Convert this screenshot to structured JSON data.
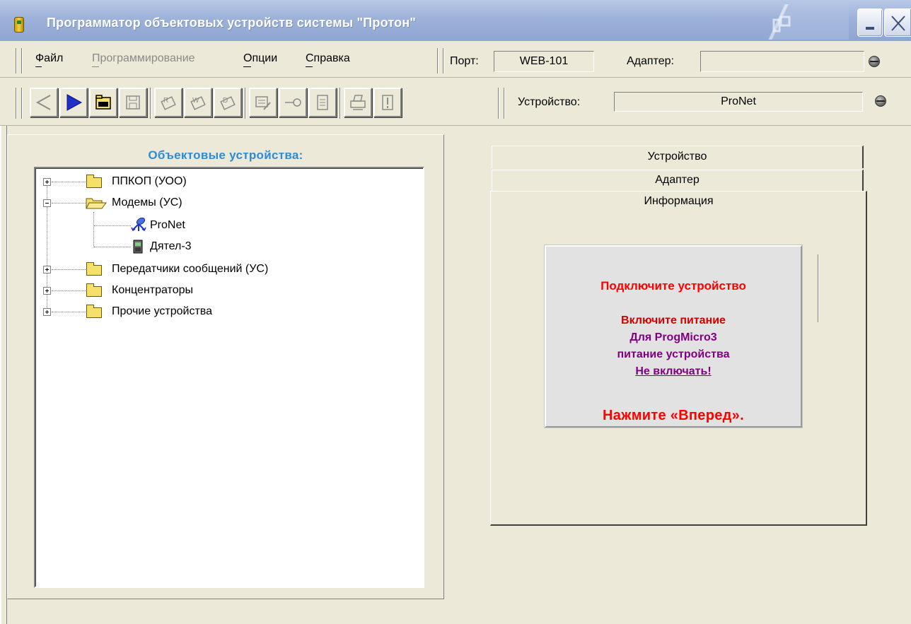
{
  "window": {
    "title": "Программатор объектовых устройств системы \"Протон\""
  },
  "menu": {
    "file": "Файл",
    "programming": "Программирование",
    "options": "Опции",
    "help": "Справка"
  },
  "status": {
    "port_label": "Порт:",
    "port_value": "WEB-101",
    "adapter_label": "Адаптер:",
    "adapter_value": "",
    "device_label": "Устройство:",
    "device_value": "ProNet"
  },
  "toolbar": {
    "buttons": [
      "back-icon",
      "forward-icon",
      "open-folder-icon",
      "save-icon",
      "read-chip-icon",
      "write-chip-icon",
      "erase-chip-icon",
      "edit-icon",
      "key-icon",
      "list-icon",
      "print-icon",
      "info-icon"
    ]
  },
  "tree": {
    "title": "Объектовые устройства:",
    "items": [
      {
        "label": "ППКОП (УОО)",
        "expanded": false
      },
      {
        "label": "Модемы (УС)",
        "expanded": true,
        "children": [
          "ProNet",
          "Дятел-3"
        ]
      },
      {
        "label": "Передатчики сообщений (УС)",
        "expanded": false
      },
      {
        "label": "Концентраторы",
        "expanded": false
      },
      {
        "label": "Прочие устройства",
        "expanded": false
      }
    ]
  },
  "tabs": {
    "device": "Устройство",
    "adapter": "Адаптер",
    "info": "Информация",
    "active": "Информация"
  },
  "info": {
    "connect": "Подключите устройство",
    "power_on": "Включите питание",
    "for_progmicro": "Для ProgMicro3",
    "device_power": "питание устройства",
    "dont_turn_on": "Не включать!",
    "press_next": "Нажмите «Вперед»."
  },
  "colors": {
    "tree_title": "#2e8cd6",
    "message_red": "#ff0000",
    "message_purple": "#800080"
  }
}
